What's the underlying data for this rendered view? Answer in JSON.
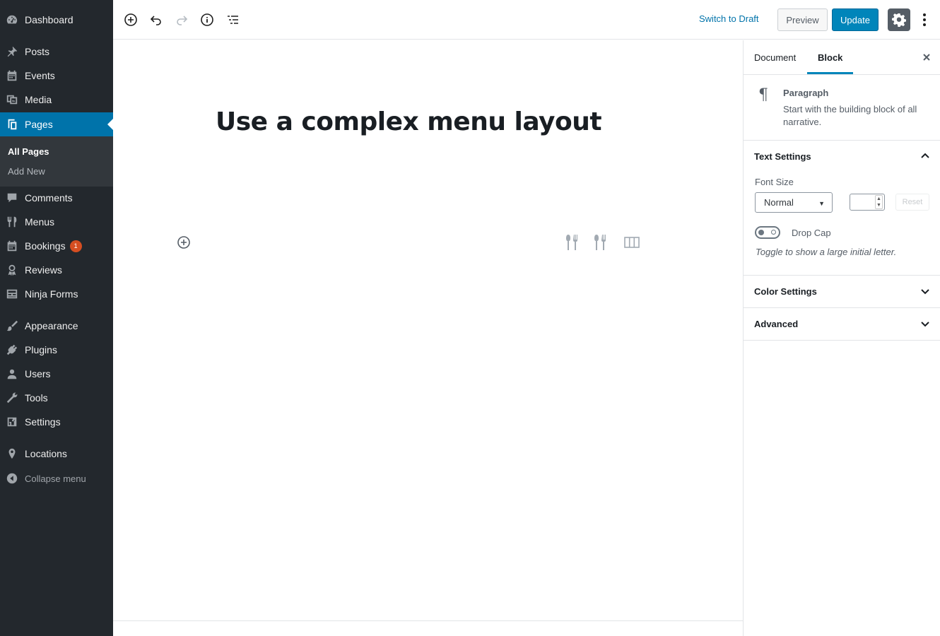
{
  "admin_menu": {
    "items": [
      {
        "label": "Dashboard",
        "icon": "dashboard-icon"
      },
      {
        "label": "Posts",
        "icon": "pin-icon"
      },
      {
        "label": "Events",
        "icon": "calendar-icon"
      },
      {
        "label": "Media",
        "icon": "media-icon"
      },
      {
        "label": "Pages",
        "icon": "pages-icon"
      },
      {
        "label": "Comments",
        "icon": "comment-icon"
      },
      {
        "label": "Menus",
        "icon": "fork-spoon-icon"
      },
      {
        "label": "Bookings",
        "icon": "calendar-icon",
        "badge": "1"
      },
      {
        "label": "Reviews",
        "icon": "award-icon"
      },
      {
        "label": "Ninja Forms",
        "icon": "form-icon"
      },
      {
        "label": "Appearance",
        "icon": "brush-icon"
      },
      {
        "label": "Plugins",
        "icon": "plug-icon"
      },
      {
        "label": "Users",
        "icon": "user-icon"
      },
      {
        "label": "Tools",
        "icon": "wrench-icon"
      },
      {
        "label": "Settings",
        "icon": "sliders-icon"
      },
      {
        "label": "Locations",
        "icon": "location-pin-icon"
      }
    ],
    "submenu": {
      "all_pages": "All Pages",
      "add_new": "Add New"
    },
    "collapse_label": "Collapse menu"
  },
  "header": {
    "switch_to_draft": "Switch to Draft",
    "preview": "Preview",
    "update": "Update"
  },
  "editor": {
    "title": "Use a complex menu layout"
  },
  "sidebar": {
    "tabs": {
      "document": "Document",
      "block": "Block"
    },
    "block_card": {
      "title": "Paragraph",
      "description": "Start with the building block of all narrative."
    },
    "text_settings": {
      "title": "Text Settings",
      "font_size_label": "Font Size",
      "font_size_value": "Normal",
      "reset": "Reset",
      "drop_cap_label": "Drop Cap",
      "drop_cap_help": "Toggle to show a large initial letter."
    },
    "color_settings": {
      "title": "Color Settings"
    },
    "advanced": {
      "title": "Advanced"
    }
  },
  "colors": {
    "admin_bg": "#23282d",
    "accent": "#0073aa",
    "button_primary": "#0085ba",
    "badge": "#d54e21"
  }
}
